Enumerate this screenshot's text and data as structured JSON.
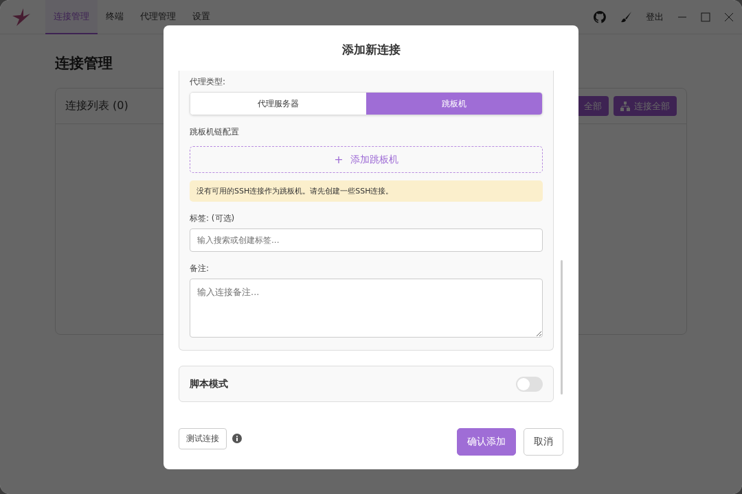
{
  "nav": {
    "tabs": [
      {
        "label": "连接管理",
        "selected": true
      },
      {
        "label": "终端",
        "selected": false
      },
      {
        "label": "代理管理",
        "selected": false
      },
      {
        "label": "设置",
        "selected": false
      }
    ],
    "logout": "登出"
  },
  "page": {
    "title": "连接管理",
    "card_title": "连接列表 (0)",
    "buttons": [
      {
        "label": "全部",
        "kind": "plain"
      },
      {
        "label": "连接全部",
        "kind": "network"
      }
    ]
  },
  "dialog": {
    "title": "添加新连接",
    "proxy_type": {
      "label": "代理类型:",
      "options": [
        {
          "label": "代理服务器",
          "selected": false
        },
        {
          "label": "跳板机",
          "selected": true
        }
      ]
    },
    "jump_chain": {
      "label": "跳板机链配置",
      "add_button": "+",
      "add_label": "添加跳板机",
      "warning": "没有可用的SSH连接作为跳板机。请先创建一些SSH连接。"
    },
    "tags": {
      "label": "标签: (可选)",
      "placeholder": "输入搜索或创建标签..."
    },
    "notes": {
      "label": "备注:",
      "placeholder": "输入连接备注..."
    },
    "script_mode": {
      "label": "脚本模式",
      "on": false
    },
    "test_button": "测试连接",
    "confirm_button": "确认添加",
    "cancel_button": "取消"
  }
}
